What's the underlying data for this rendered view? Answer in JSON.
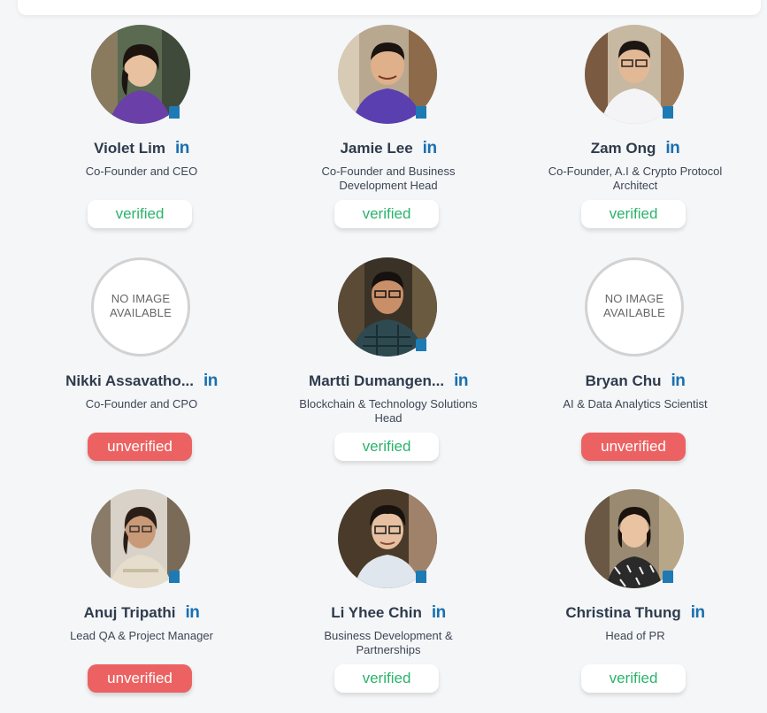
{
  "colors": {
    "verified_text": "#2bb36b",
    "unverified_bg": "#ec6262",
    "linkedin": "#1a6fb0",
    "name_text": "#2f3b4c"
  },
  "team": [
    {
      "name": "Violet Lim",
      "role": "Co-Founder and CEO",
      "status": "verified",
      "linkedin": "in",
      "photo": "photo-woman-purple"
    },
    {
      "name": "Jamie Lee",
      "role": "Co-Founder and Business Development Head",
      "status": "verified",
      "linkedin": "in",
      "photo": "photo-man-purple"
    },
    {
      "name": "Zam Ong",
      "role": "Co-Founder, A.I & Crypto Protocol Architect",
      "status": "verified",
      "linkedin": "in",
      "photo": "photo-man-white"
    },
    {
      "name": "Nikki Assavatho...",
      "role": "Co-Founder and CPO",
      "status": "unverified",
      "linkedin": "in",
      "photo": "no-image",
      "no_image_text": "NO IMAGE AVAILABLE"
    },
    {
      "name": "Martti Dumangen...",
      "role": "Blockchain & Technology Solutions Head",
      "status": "verified",
      "linkedin": "in",
      "photo": "photo-man-plaid"
    },
    {
      "name": "Bryan Chu",
      "role": "AI & Data Analytics Scientist",
      "status": "unverified",
      "linkedin": "in",
      "photo": "no-image",
      "no_image_text": "NO IMAGE AVAILABLE"
    },
    {
      "name": "Anuj Tripathi",
      "role": "Lead QA & Project Manager",
      "status": "unverified",
      "linkedin": "in",
      "photo": "photo-woman-beige"
    },
    {
      "name": "Li Yhee Chin",
      "role": "Business Development & Partnerships",
      "status": "verified",
      "linkedin": "in",
      "photo": "photo-man-glasses"
    },
    {
      "name": "Christina Thung",
      "role": "Head of PR",
      "status": "verified",
      "linkedin": "in",
      "photo": "photo-woman-pattern"
    }
  ]
}
